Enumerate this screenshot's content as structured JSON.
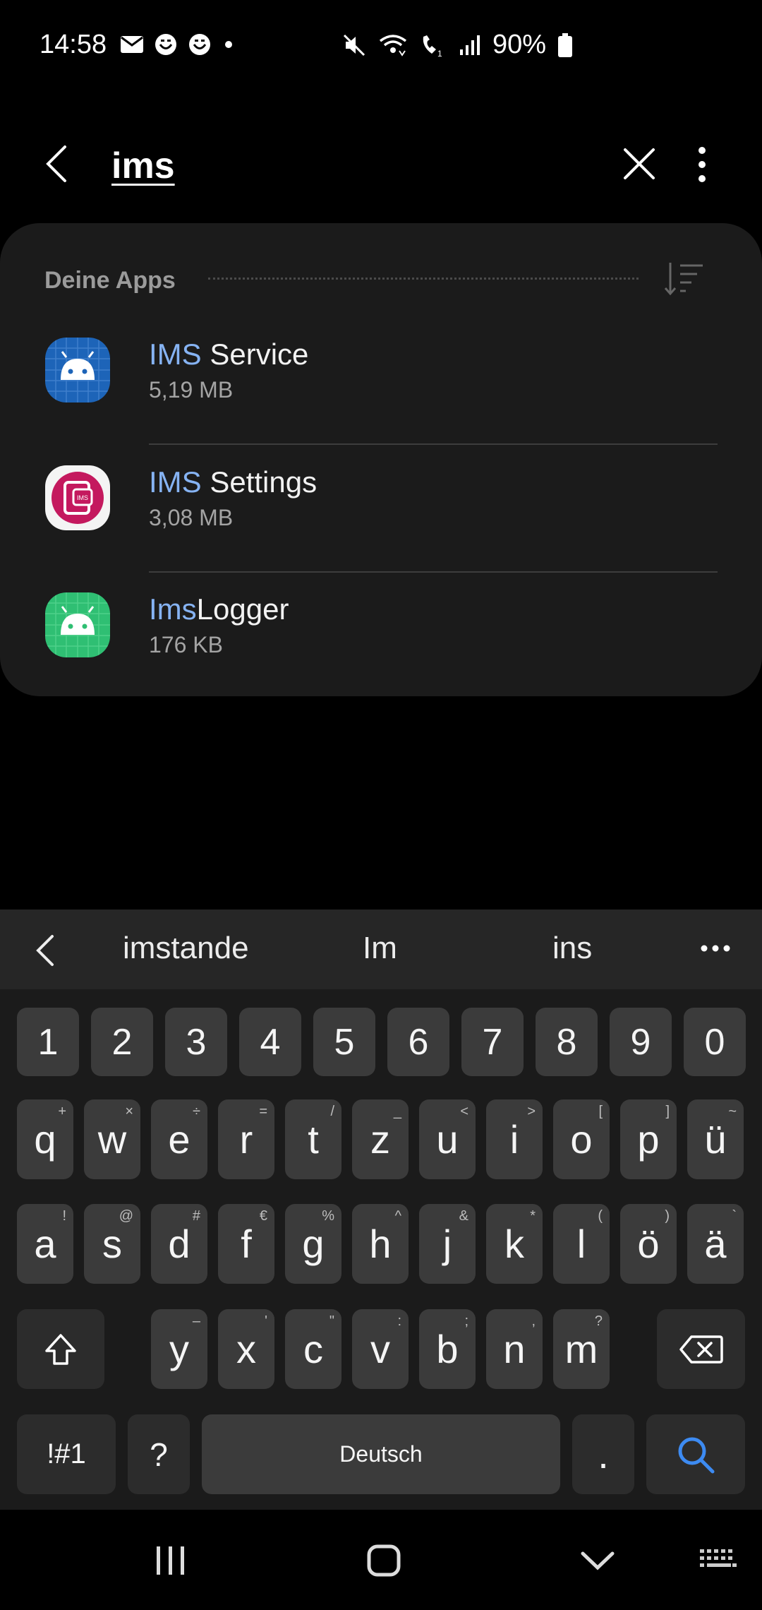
{
  "status_bar": {
    "time": "14:58",
    "left_icons": [
      "mail-icon",
      "smiley-icon",
      "smiley-icon",
      "dot-icon"
    ],
    "right_icons": [
      "mute-icon",
      "wifi-calling-icon",
      "volte-call-icon",
      "signal-icon"
    ],
    "battery": "90%"
  },
  "search": {
    "query": "ims"
  },
  "results": {
    "section_label": "Deine Apps",
    "apps": [
      {
        "highlight": "IMS",
        "rest": " Service",
        "size": "5,19 MB",
        "icon": "android-blue-icon"
      },
      {
        "highlight": "IMS",
        "rest": " Settings",
        "size": "3,08 MB",
        "icon": "ims-settings-icon"
      },
      {
        "highlight": "Ims",
        "rest": "Logger",
        "size": "176 KB",
        "icon": "android-green-icon"
      }
    ]
  },
  "keyboard": {
    "suggestions": [
      "imstande",
      "Im",
      "ins"
    ],
    "number_row": [
      "1",
      "2",
      "3",
      "4",
      "5",
      "6",
      "7",
      "8",
      "9",
      "0"
    ],
    "row1": [
      {
        "k": "q",
        "a": "+"
      },
      {
        "k": "w",
        "a": "×"
      },
      {
        "k": "e",
        "a": "÷"
      },
      {
        "k": "r",
        "a": "="
      },
      {
        "k": "t",
        "a": "/"
      },
      {
        "k": "z",
        "a": "_"
      },
      {
        "k": "u",
        "a": "<"
      },
      {
        "k": "i",
        "a": ">"
      },
      {
        "k": "o",
        "a": "["
      },
      {
        "k": "p",
        "a": "]"
      },
      {
        "k": "ü",
        "a": "~"
      }
    ],
    "row2": [
      {
        "k": "a",
        "a": "!"
      },
      {
        "k": "s",
        "a": "@"
      },
      {
        "k": "d",
        "a": "#"
      },
      {
        "k": "f",
        "a": "€"
      },
      {
        "k": "g",
        "a": "%"
      },
      {
        "k": "h",
        "a": "^"
      },
      {
        "k": "j",
        "a": "&"
      },
      {
        "k": "k",
        "a": "*"
      },
      {
        "k": "l",
        "a": "("
      },
      {
        "k": "ö",
        "a": ")"
      },
      {
        "k": "ä",
        "a": "`"
      }
    ],
    "row3": [
      {
        "k": "y",
        "a": "–"
      },
      {
        "k": "x",
        "a": "'"
      },
      {
        "k": "c",
        "a": "\""
      },
      {
        "k": "v",
        "a": ":"
      },
      {
        "k": "b",
        "a": ";"
      },
      {
        "k": "n",
        "a": ","
      },
      {
        "k": "m",
        "a": "?"
      }
    ],
    "symbols_key": "!#1",
    "question_key": "?",
    "space_label": "Deutsch",
    "period_key": ".",
    "accent_color": "#3d8bf2"
  },
  "colors": {
    "highlight": "#86b3f3",
    "card_bg": "#1b1b1b"
  }
}
